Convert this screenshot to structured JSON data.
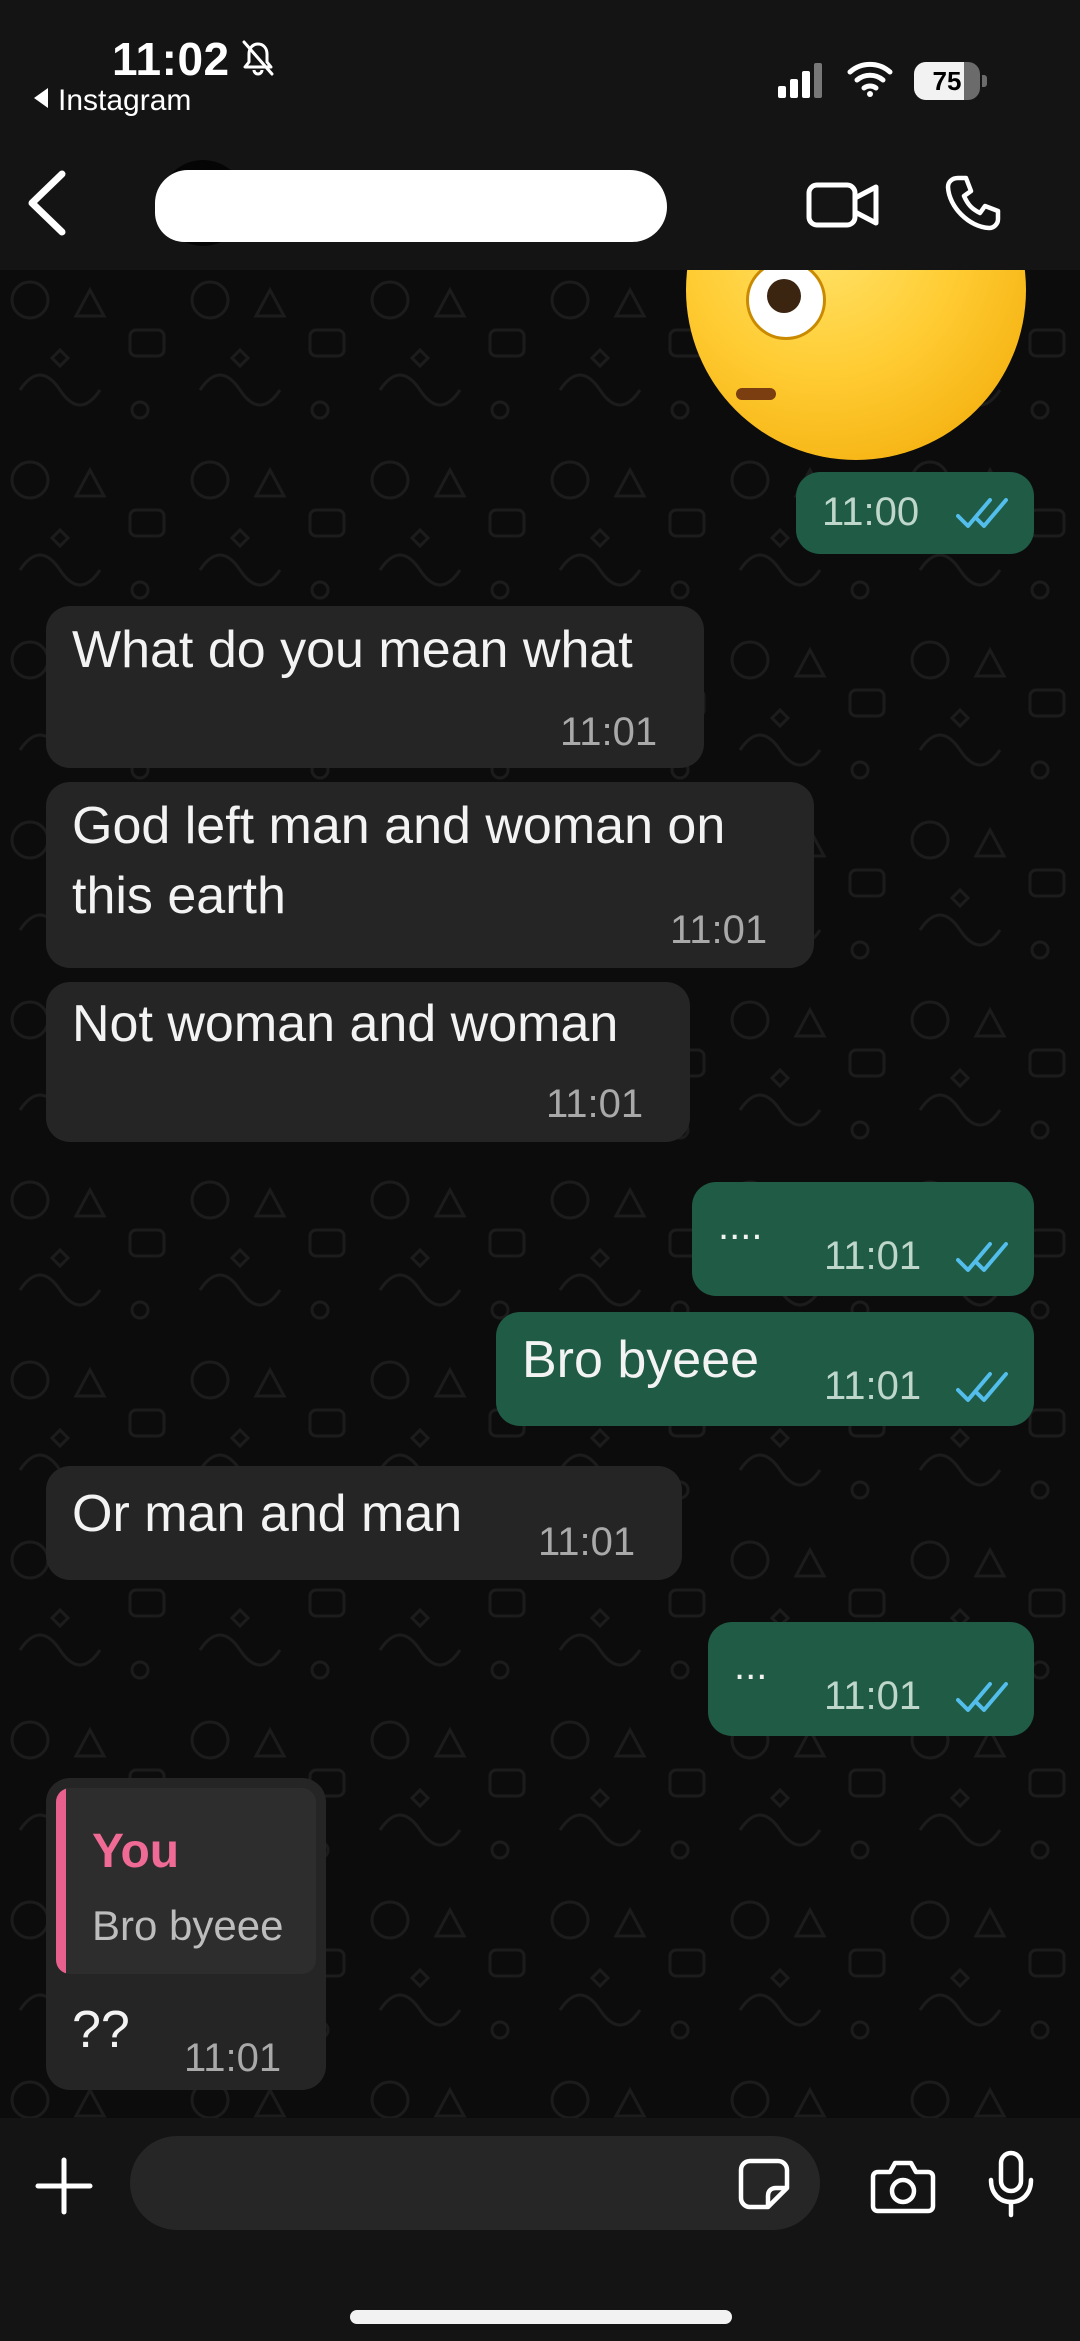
{
  "status_bar": {
    "time": "11:02",
    "back_app": "Instagram",
    "battery": "75",
    "battery_level": 0.75,
    "icons": [
      "mute-bell-icon",
      "signal-icon",
      "wifi-icon",
      "battery-icon"
    ]
  },
  "header": {
    "contact_name": "",
    "icons": [
      "back-chevron-icon",
      "video-call-icon",
      "voice-call-icon"
    ]
  },
  "messages": [
    {
      "id": "m0",
      "direction": "outgoing",
      "type": "emoji-sticker",
      "emoji": "face-with-rolling-eyes"
    },
    {
      "id": "m1",
      "direction": "outgoing",
      "text": "",
      "time": "11:00",
      "read": true
    },
    {
      "id": "m2",
      "direction": "incoming",
      "text": "What do you mean what",
      "time": "11:01"
    },
    {
      "id": "m3",
      "direction": "incoming",
      "text_line1": "God left man and woman on",
      "text_line2": "this earth",
      "time": "11:01"
    },
    {
      "id": "m4",
      "direction": "incoming",
      "text": "Not woman and woman",
      "time": "11:01"
    },
    {
      "id": "m5",
      "direction": "outgoing",
      "text": "....",
      "time": "11:01",
      "read": true
    },
    {
      "id": "m6",
      "direction": "outgoing",
      "text": "Bro byeee",
      "time": "11:01",
      "read": true
    },
    {
      "id": "m7",
      "direction": "incoming",
      "text": "Or man and man",
      "time": "11:01"
    },
    {
      "id": "m8",
      "direction": "outgoing",
      "text": "...",
      "time": "11:01",
      "read": true
    },
    {
      "id": "m9",
      "direction": "incoming",
      "reply_to": {
        "author": "You",
        "text": "Bro byeee"
      },
      "text": "??",
      "time": "11:01"
    }
  ],
  "composer": {
    "placeholder": "",
    "icons": [
      "plus-icon",
      "sticker-icon",
      "camera-icon",
      "microphone-icon"
    ]
  },
  "colors": {
    "incoming_bubble": "#252525",
    "outgoing_bubble": "#1f5b45",
    "read_ticks": "#53bdeb",
    "quote_accent": "#ef6b96"
  }
}
